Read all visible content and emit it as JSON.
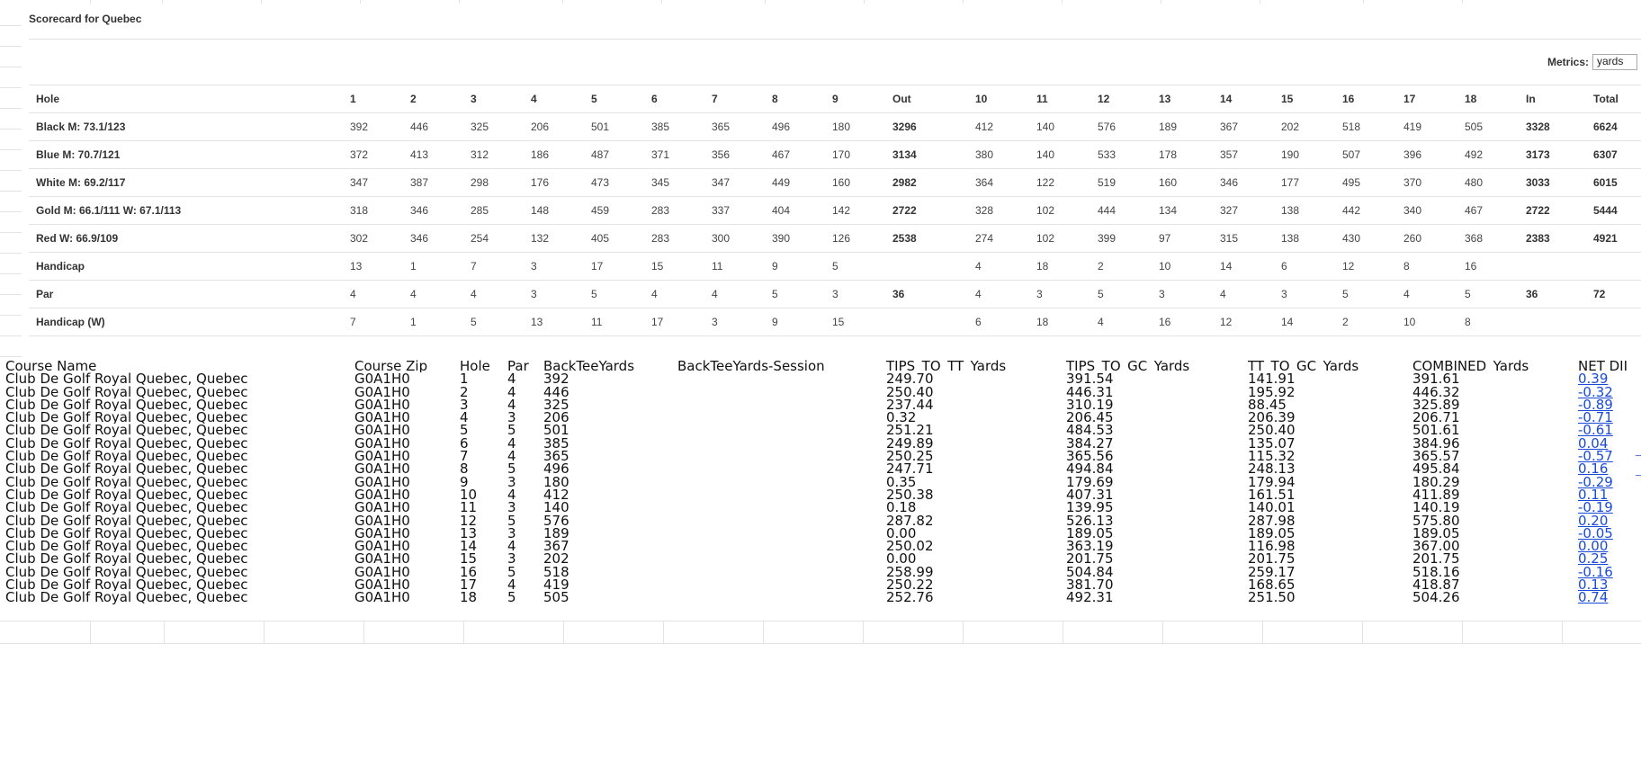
{
  "scorecard": {
    "title": "Scorecard for Quebec",
    "metrics_label": "Metrics:",
    "metrics_value": "yards",
    "header": [
      "Hole",
      "1",
      "2",
      "3",
      "4",
      "5",
      "6",
      "7",
      "8",
      "9",
      "Out",
      "10",
      "11",
      "12",
      "13",
      "14",
      "15",
      "16",
      "17",
      "18",
      "In",
      "Total"
    ],
    "rows": [
      [
        "Black M: 73.1/123",
        "392",
        "446",
        "325",
        "206",
        "501",
        "385",
        "365",
        "496",
        "180",
        "3296",
        "412",
        "140",
        "576",
        "189",
        "367",
        "202",
        "518",
        "419",
        "505",
        "3328",
        "6624"
      ],
      [
        "Blue M: 70.7/121",
        "372",
        "413",
        "312",
        "186",
        "487",
        "371",
        "356",
        "467",
        "170",
        "3134",
        "380",
        "140",
        "533",
        "178",
        "357",
        "190",
        "507",
        "396",
        "492",
        "3173",
        "6307"
      ],
      [
        "White M: 69.2/117",
        "347",
        "387",
        "298",
        "176",
        "473",
        "345",
        "347",
        "449",
        "160",
        "2982",
        "364",
        "122",
        "519",
        "160",
        "346",
        "177",
        "495",
        "370",
        "480",
        "3033",
        "6015"
      ],
      [
        "Gold M: 66.1/111 W: 67.1/113",
        "318",
        "346",
        "285",
        "148",
        "459",
        "283",
        "337",
        "404",
        "142",
        "2722",
        "328",
        "102",
        "444",
        "134",
        "327",
        "138",
        "442",
        "340",
        "467",
        "2722",
        "5444"
      ],
      [
        "Red W: 66.9/109",
        "302",
        "346",
        "254",
        "132",
        "405",
        "283",
        "300",
        "390",
        "126",
        "2538",
        "274",
        "102",
        "399",
        "97",
        "315",
        "138",
        "430",
        "260",
        "368",
        "2383",
        "4921"
      ],
      [
        "Handicap",
        "13",
        "1",
        "7",
        "3",
        "17",
        "15",
        "11",
        "9",
        "5",
        "",
        "4",
        "18",
        "2",
        "10",
        "14",
        "6",
        "12",
        "8",
        "16",
        "",
        ""
      ],
      [
        "Par",
        "4",
        "4",
        "4",
        "3",
        "5",
        "4",
        "4",
        "5",
        "3",
        "36",
        "4",
        "3",
        "5",
        "3",
        "4",
        "3",
        "5",
        "4",
        "5",
        "36",
        "72"
      ],
      [
        "Handicap (W)",
        "7",
        "1",
        "5",
        "13",
        "11",
        "17",
        "3",
        "9",
        "15",
        "",
        "6",
        "18",
        "4",
        "16",
        "12",
        "14",
        "2",
        "10",
        "8",
        "",
        ""
      ]
    ]
  },
  "data_table": {
    "columns": [
      "Course Name",
      "Course Zip",
      "Hole",
      "Par",
      "BackTeeYards",
      "BackTeeYards-Session",
      "TIPS_TO_TT_Yards",
      "TIPS_TO_GC_Yards",
      "TT_TO_GC_Yards",
      "COMBINED_Yards",
      "NET DII"
    ],
    "rows": [
      [
        "Club De Golf Royal Quebec, Quebec",
        "G0A1H0",
        "1",
        "4",
        "392",
        "",
        "249.70",
        "391.54",
        "141.91",
        "391.61",
        "0.39"
      ],
      [
        "Club De Golf Royal Quebec, Quebec",
        "G0A1H0",
        "2",
        "4",
        "446",
        "",
        "250.40",
        "446.31",
        "195.92",
        "446.32",
        "-0.32"
      ],
      [
        "Club De Golf Royal Quebec, Quebec",
        "G0A1H0",
        "3",
        "4",
        "325",
        "",
        "237.44",
        "310.19",
        "88.45",
        "325.89",
        "-0.89"
      ],
      [
        "Club De Golf Royal Quebec, Quebec",
        "G0A1H0",
        "4",
        "3",
        "206",
        "",
        "0.32",
        "206.45",
        "206.39",
        "206.71",
        "-0.71"
      ],
      [
        "Club De Golf Royal Quebec, Quebec",
        "G0A1H0",
        "5",
        "5",
        "501",
        "",
        "251.21",
        "484.53",
        "250.40",
        "501.61",
        "-0.61"
      ],
      [
        "Club De Golf Royal Quebec, Quebec",
        "G0A1H0",
        "6",
        "4",
        "385",
        "",
        "249.89",
        "384.27",
        "135.07",
        "384.96",
        "0.04"
      ],
      [
        "Club De Golf Royal Quebec, Quebec",
        "G0A1H0",
        "7",
        "4",
        "365",
        "",
        "250.25",
        "365.56",
        "115.32",
        "365.57",
        "-0.57"
      ],
      [
        "Club De Golf Royal Quebec, Quebec",
        "G0A1H0",
        "8",
        "5",
        "496",
        "",
        "247.71",
        "494.84",
        "248.13",
        "495.84",
        "0.16"
      ],
      [
        "Club De Golf Royal Quebec, Quebec",
        "G0A1H0",
        "9",
        "3",
        "180",
        "",
        "0.35",
        "179.69",
        "179.94",
        "180.29",
        "-0.29"
      ],
      [
        "Club De Golf Royal Quebec, Quebec",
        "G0A1H0",
        "10",
        "4",
        "412",
        "",
        "250.38",
        "407.31",
        "161.51",
        "411.89",
        "0.11"
      ],
      [
        "Club De Golf Royal Quebec, Quebec",
        "G0A1H0",
        "11",
        "3",
        "140",
        "",
        "0.18",
        "139.95",
        "140.01",
        "140.19",
        "-0.19"
      ],
      [
        "Club De Golf Royal Quebec, Quebec",
        "G0A1H0",
        "12",
        "5",
        "576",
        "",
        "287.82",
        "526.13",
        "287.98",
        "575.80",
        "0.20"
      ],
      [
        "Club De Golf Royal Quebec, Quebec",
        "G0A1H0",
        "13",
        "3",
        "189",
        "",
        "0.00",
        "189.05",
        "189.05",
        "189.05",
        "-0.05"
      ],
      [
        "Club De Golf Royal Quebec, Quebec",
        "G0A1H0",
        "14",
        "4",
        "367",
        "",
        "250.02",
        "363.19",
        "116.98",
        "367.00",
        "0.00"
      ],
      [
        "Club De Golf Royal Quebec, Quebec",
        "G0A1H0",
        "15",
        "3",
        "202",
        "",
        "0.00",
        "201.75",
        "201.75",
        "201.75",
        "0.25"
      ],
      [
        "Club De Golf Royal Quebec, Quebec",
        "G0A1H0",
        "16",
        "5",
        "518",
        "",
        "258.99",
        "504.84",
        "259.17",
        "518.16",
        "-0.16"
      ],
      [
        "Club De Golf Royal Quebec, Quebec",
        "G0A1H0",
        "17",
        "4",
        "419",
        "",
        "250.22",
        "381.70",
        "168.65",
        "418.87",
        "0.13"
      ],
      [
        "Club De Golf Royal Quebec, Quebec",
        "G0A1H0",
        "18",
        "5",
        "505",
        "",
        "252.76",
        "492.31",
        "251.50",
        "504.26",
        "0.74"
      ]
    ]
  },
  "colors": {
    "link": "#1a4ad8",
    "grid": "#e3e3e3"
  }
}
